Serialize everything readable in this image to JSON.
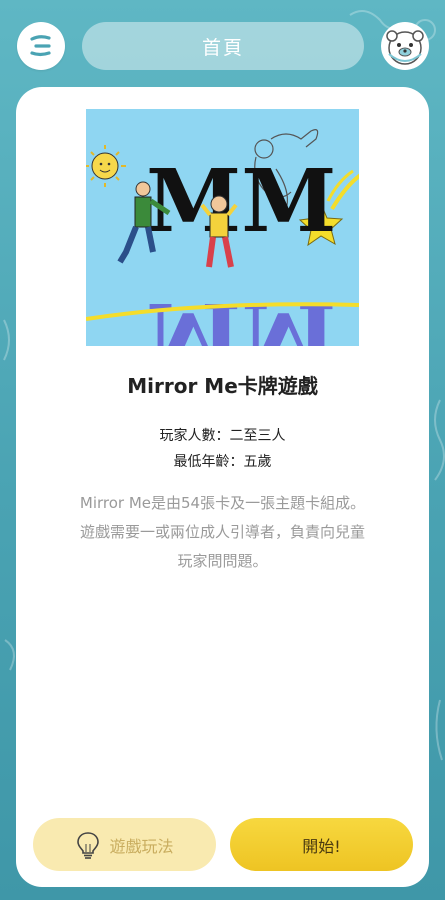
{
  "header": {
    "title": "首頁",
    "menu_icon": "menu-icon",
    "avatar_icon": "bear-avatar-icon"
  },
  "game": {
    "hero_text_top": "MM",
    "hero_text_bottom": "MM",
    "title": "Mirror Me卡牌遊戲",
    "players": "玩家人數：二至三人",
    "min_age": "最低年齡：五歲",
    "description_lines": [
      "Mirror Me是由54張卡及一張主題卡組成。",
      "遊戲需要一或兩位成人引導者，負責向兒童",
      "玩家問問題。"
    ]
  },
  "actions": {
    "howto_label": "遊戲玩法",
    "howto_icon": "lightbulb-icon",
    "start_label": "開始!"
  },
  "colors": {
    "background": "#4aa3b3",
    "accent_yellow": "#eec423",
    "pale_yellow": "#f9eab0",
    "hero_sky": "#8fd6f2"
  }
}
